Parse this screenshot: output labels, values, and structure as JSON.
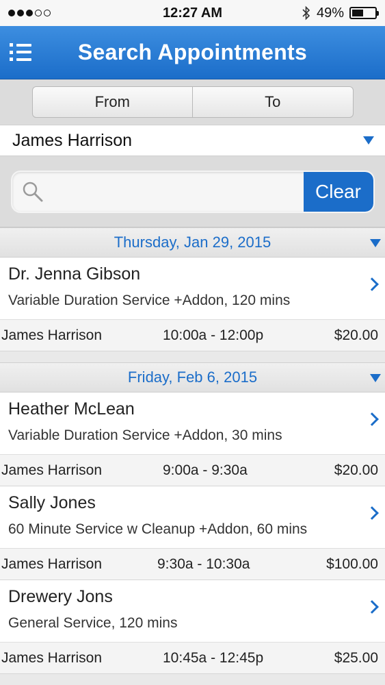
{
  "status_bar": {
    "time": "12:27 AM",
    "battery": "49%",
    "battery_level": 0.49,
    "signal_bars": 5,
    "signal_filled": 3
  },
  "header": {
    "title": "Search Appointments",
    "menu_icon": "list-menu-icon"
  },
  "range": {
    "from_label": "From",
    "to_label": "To"
  },
  "provider": {
    "selected": "James Harrison"
  },
  "search": {
    "placeholder": "",
    "value": "",
    "clear_label": "Clear"
  },
  "colors": {
    "accent": "#1b6dc9",
    "header_top": "#3d8ee0"
  },
  "groups": [
    {
      "date": "Thursday, Jan 29, 2015",
      "appointments": [
        {
          "name": "Dr. Jenna Gibson",
          "service": "Variable Duration Service +Addon, 120 mins",
          "client": "James Harrison",
          "time": "10:00a - 12:00p",
          "price": "$20.00"
        }
      ]
    },
    {
      "date": "Friday, Feb 6, 2015",
      "appointments": [
        {
          "name": "Heather McLean",
          "service": "Variable Duration Service +Addon, 30 mins",
          "client": "James Harrison",
          "time": "9:00a - 9:30a",
          "price": "$20.00"
        },
        {
          "name": "Sally Jones",
          "service": "60 Minute Service w Cleanup +Addon, 60 mins",
          "client": "James Harrison",
          "time": "9:30a - 10:30a",
          "price": "$100.00"
        },
        {
          "name": "Drewery Jons",
          "service": "General Service, 120 mins",
          "client": "James Harrison",
          "time": "10:45a - 12:45p",
          "price": "$25.00"
        }
      ]
    }
  ]
}
